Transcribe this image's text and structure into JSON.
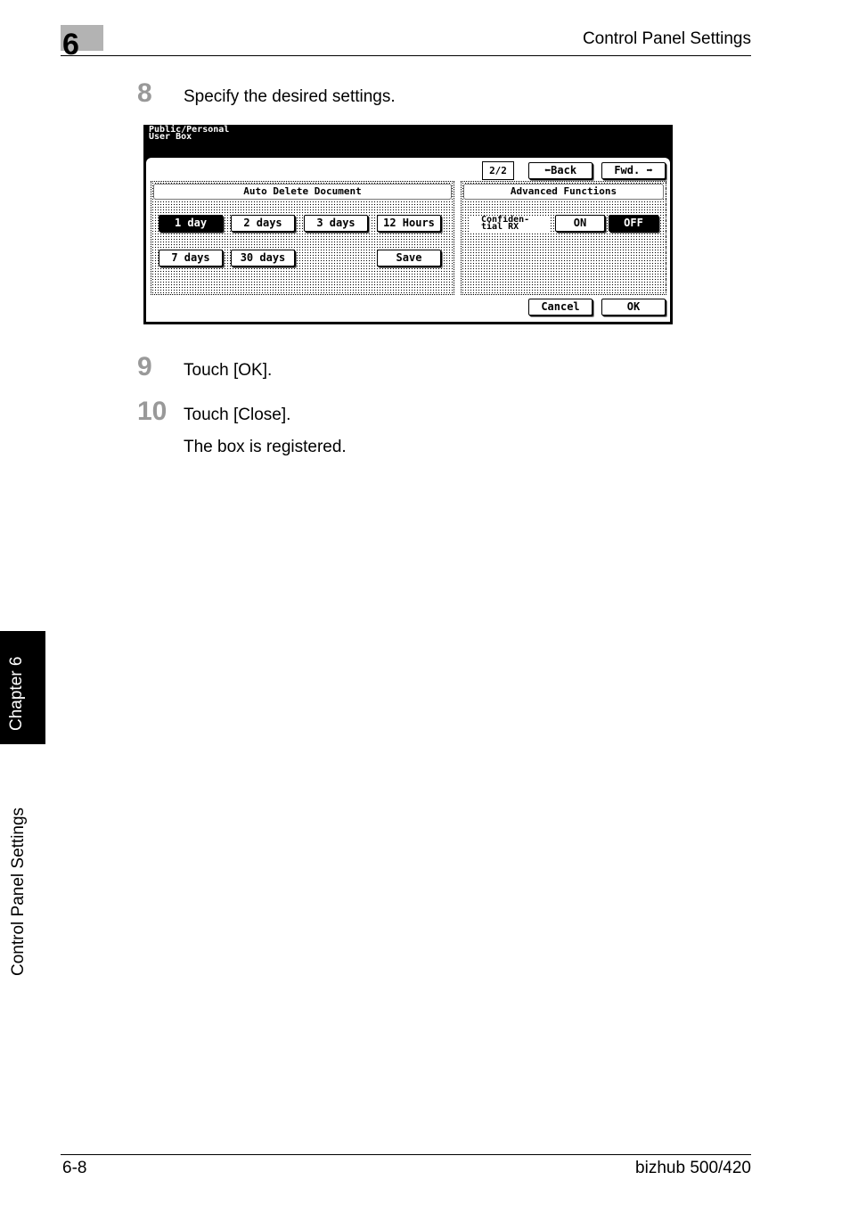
{
  "header": {
    "chapter_number": "6",
    "section_title": "Control Panel Settings"
  },
  "steps": [
    {
      "number": "8",
      "text": "Specify the desired settings."
    },
    {
      "number": "9",
      "text": "Touch [OK]."
    },
    {
      "number": "10",
      "text": "Touch [Close].",
      "note": "The box is registered."
    }
  ],
  "screen": {
    "title_line1": "Public/Personal",
    "title_line2": "User Box",
    "page_indicator": "2/2",
    "back_label": "Back",
    "fwd_label": "Fwd.",
    "auto_delete": {
      "heading": "Auto Delete Document",
      "options": [
        "1 day",
        "2 days",
        "3 days",
        "12 Hours",
        "7 days",
        "30 days"
      ],
      "selected": "1 day",
      "save_label": "Save"
    },
    "advanced": {
      "heading": "Advanced Functions",
      "confidential_line1": "Confiden-",
      "confidential_line2": "tial RX",
      "on_label": "ON",
      "off_label": "OFF",
      "selected": "OFF"
    },
    "cancel_label": "Cancel",
    "ok_label": "OK"
  },
  "sidebar": {
    "chapter_tab": "Chapter 6",
    "section_tab": "Control Panel Settings"
  },
  "footer": {
    "page_number": "6-8",
    "product": "bizhub 500/420"
  }
}
